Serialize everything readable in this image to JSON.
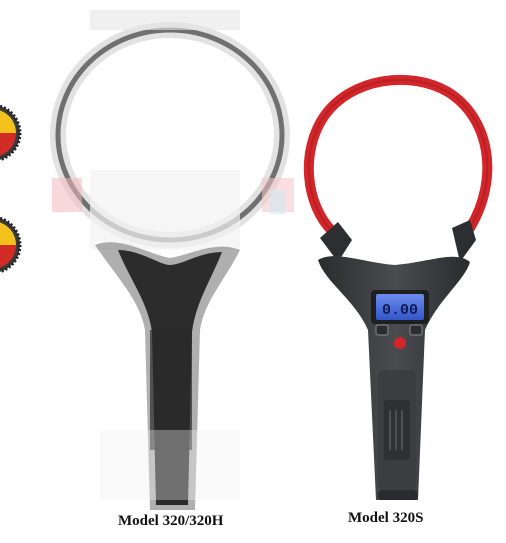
{
  "products": [
    {
      "caption": "Model 320/320H"
    },
    {
      "caption": "Model 320S"
    }
  ],
  "display_reading": "0.00",
  "colors": {
    "coil_red": "#d3262b",
    "body_dark": "#3d3f42",
    "lcd_blue": "#4a6fe0",
    "badge_yellow": "#f3c21c",
    "badge_blue": "#244e9e",
    "badge_red": "#d32c27"
  }
}
